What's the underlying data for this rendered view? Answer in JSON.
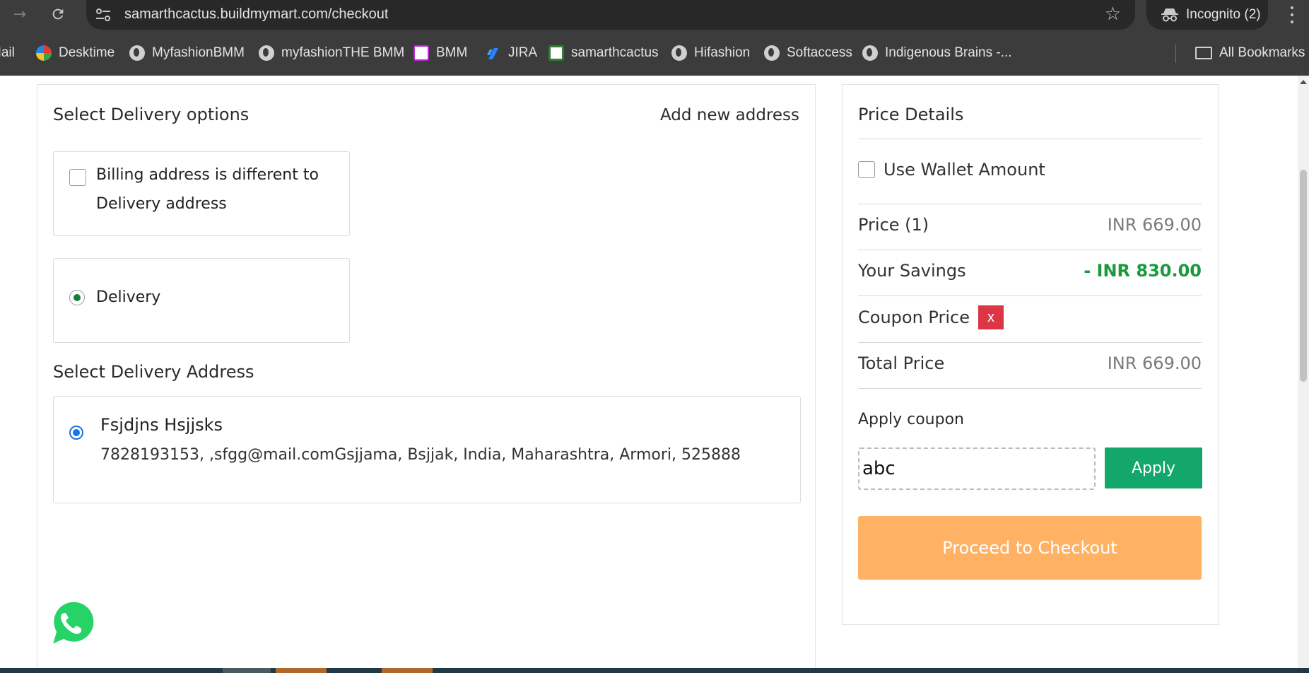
{
  "browser": {
    "url": "samarthcactus.buildmymart.com/checkout",
    "incognito_label": "Incognito (2)",
    "bookmarks": [
      {
        "label": "Mail"
      },
      {
        "label": "Desktime"
      },
      {
        "label": "MyfashionBMM"
      },
      {
        "label": "myfashionTHE BMM"
      },
      {
        "label": "BMM"
      },
      {
        "label": "JIRA"
      },
      {
        "label": "samarthcactus"
      },
      {
        "label": "Hifashion"
      },
      {
        "label": "Softaccess"
      },
      {
        "label": "Indigenous Brains -..."
      }
    ],
    "all_bookmarks_label": "All Bookmarks"
  },
  "delivery": {
    "title": "Select Delivery options",
    "add_new_address": "Add new address",
    "billing_line1": "Billing address is different to",
    "billing_line2": "Delivery address",
    "delivery_option": "Delivery",
    "address_title": "Select Delivery Address",
    "address": {
      "name": "Fsjdjns Hsjjsks",
      "detail": "7828193153, ,sfgg@mail.comGsjjama, Bsjjak, India, Maharashtra, Armori, 525888"
    }
  },
  "price": {
    "title": "Price Details",
    "wallet_label": "Use Wallet Amount",
    "price_label": "Price (1)",
    "price_value": "INR 669.00",
    "savings_label": "Your Savings",
    "savings_value": "- INR 830.00",
    "coupon_label": "Coupon Price",
    "coupon_remove": "x",
    "total_label": "Total Price",
    "total_value": "INR 669.00",
    "apply_coupon_title": "Apply coupon",
    "coupon_input_value": "abc",
    "apply_label": "Apply",
    "checkout_label": "Proceed to Checkout"
  },
  "colors": {
    "accent_green": "#14a76c",
    "checkout_orange": "#ffb263",
    "savings_green": "#1a9a3c",
    "remove_red": "#dc3545"
  }
}
